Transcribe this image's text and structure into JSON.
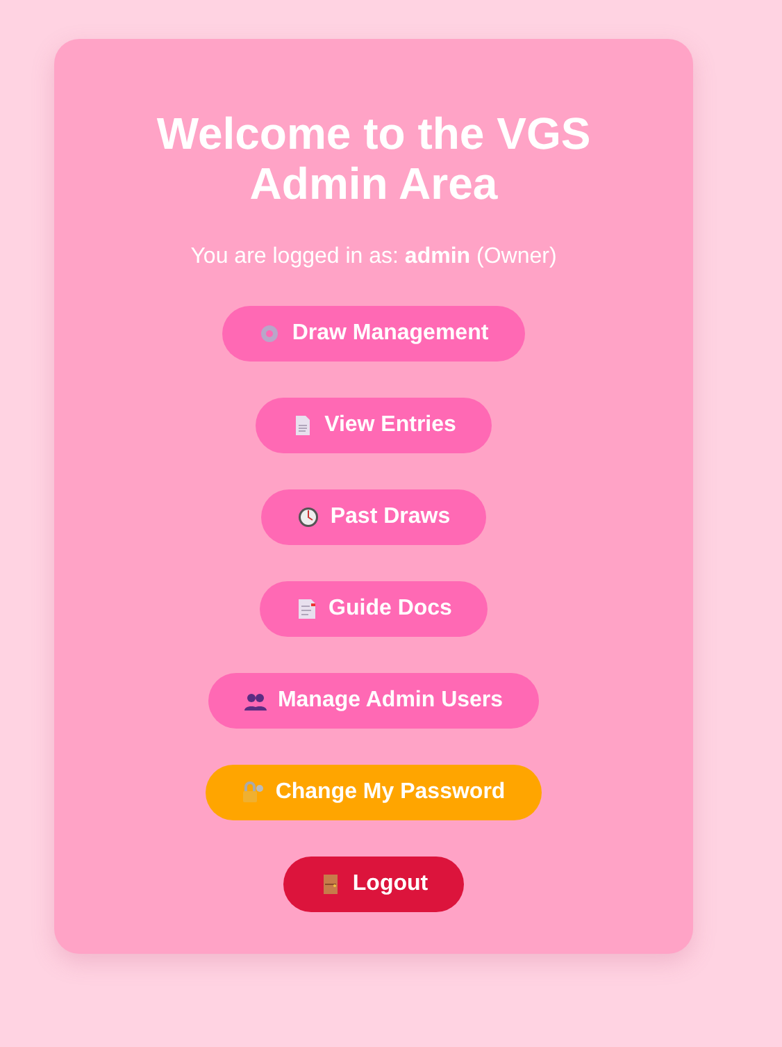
{
  "title": "Welcome to the VGS Admin Area",
  "login": {
    "prefix": "You are logged in as:",
    "user": "admin",
    "role": "(Owner)"
  },
  "buttons": [
    {
      "label": "Draw Management",
      "kind": "primary"
    },
    {
      "label": "View Entries",
      "kind": "primary"
    },
    {
      "label": "Past Draws",
      "kind": "primary"
    },
    {
      "label": "Guide Docs",
      "kind": "primary"
    },
    {
      "label": "Manage Admin Users",
      "kind": "primary"
    },
    {
      "label": "Change My Password",
      "kind": "warning"
    },
    {
      "label": "Logout",
      "kind": "danger"
    }
  ]
}
